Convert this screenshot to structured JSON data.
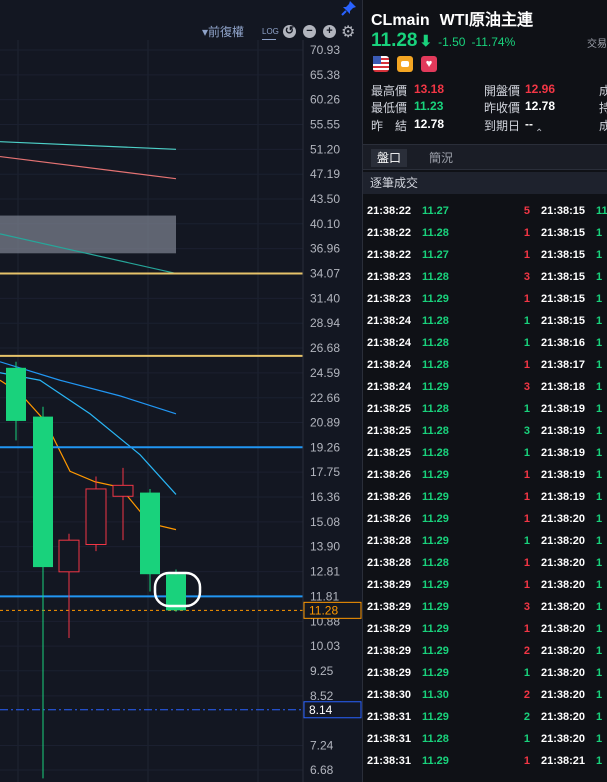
{
  "toolbar": {
    "adjust_label": "▾前復權",
    "log_label": "LOG",
    "reset_symbol": "↺",
    "zoom_out_symbol": "−",
    "zoom_in_symbol": "+",
    "settings_symbol": "⚙"
  },
  "chart_data": {
    "type": "candlestick",
    "y_axis_ticks": [
      "70.93",
      "65.38",
      "60.26",
      "55.55",
      "51.20",
      "47.19",
      "43.50",
      "40.10",
      "36.96",
      "34.07",
      "31.40",
      "28.94",
      "26.68",
      "24.59",
      "22.66",
      "20.89",
      "19.26",
      "17.75",
      "16.36",
      "15.08",
      "13.90",
      "12.81",
      "11.81",
      "10.88",
      "10.03",
      "9.25",
      "8.52",
      "7.24",
      "6.68"
    ],
    "y_log_scale": true,
    "current_price_tag": "11.28",
    "reference_price_tag": "8.14",
    "horizontal_lines": [
      {
        "value": 34.07,
        "color": "#e6c36a"
      },
      {
        "value": 26.0,
        "color": "#e6c36a"
      },
      {
        "value": 19.26,
        "color": "#2196f3"
      },
      {
        "value": 11.81,
        "color": "#2196f3"
      },
      {
        "value": 11.28,
        "color": "#ff9800"
      },
      {
        "value": 8.14,
        "color": "#2962ff"
      }
    ],
    "candles": [
      {
        "open": 25.0,
        "high": 25.5,
        "low": 19.7,
        "close": 21.0,
        "color": "green"
      },
      {
        "open": 21.3,
        "high": 22.0,
        "low": 6.5,
        "close": 13.0,
        "color": "green"
      },
      {
        "open": 12.8,
        "high": 14.5,
        "low": 10.3,
        "close": 14.2,
        "color": "red"
      },
      {
        "open": 14.0,
        "high": 17.5,
        "low": 13.7,
        "close": 16.8,
        "color": "red"
      },
      {
        "open": 16.4,
        "high": 18.0,
        "low": 14.2,
        "close": 17.0,
        "color": "red"
      },
      {
        "open": 16.6,
        "high": 16.8,
        "low": 12.0,
        "close": 12.7,
        "color": "green"
      },
      {
        "open": 12.7,
        "high": 12.9,
        "low": 11.23,
        "close": 11.28,
        "color": "green"
      }
    ],
    "moving_averages": [
      {
        "name": "MA-cyan",
        "color": "#4dd0c8",
        "values": [
          52.5,
          51.2
        ]
      },
      {
        "name": "MA-pink",
        "color": "#e57373",
        "values": [
          50.0,
          46.5
        ]
      },
      {
        "name": "MA-green",
        "color": "#26a69a",
        "values": [
          38.8,
          34.07
        ]
      },
      {
        "name": "MA-blue",
        "color": "#2196f3",
        "values": [
          25.5,
          21.5
        ]
      },
      {
        "name": "MA-lightblue",
        "color": "#29b6f6",
        "values": [
          24.6,
          16.5
        ]
      },
      {
        "name": "MA-orange",
        "color": "#ff9800",
        "values": [
          24.0,
          14.7
        ]
      }
    ],
    "shaded_band": {
      "from": 36.4,
      "to": 41.2
    }
  },
  "quote": {
    "symbol": "CLmain",
    "name": "WTI原油主連",
    "exchange": "交易",
    "price": "11.28",
    "arrow": "⬇",
    "change": "-1.50",
    "change_pct": "-11.74%",
    "colors": {
      "up": "#f23645",
      "down": "#19d27c"
    },
    "stats": {
      "high_label": "最高價",
      "high": "13.18",
      "low_label": "最低價",
      "low": "11.23",
      "prev_settle_label": "昨　結",
      "prev_settle": "12.78",
      "open_label": "開盤價",
      "open": "12.96",
      "prev_close_label": "昨收價",
      "prev_close": "12.78",
      "expiry_label": "到期日",
      "expiry": "--",
      "cut1": "成",
      "cut2": "持",
      "cut3": "成"
    },
    "expand_symbol": "⌃"
  },
  "tabs": {
    "orderbook": "盤口",
    "brief": "簡況"
  },
  "ticks_header": "逐筆成交",
  "ticks": [
    {
      "time": "21:38:22",
      "price": "11.27",
      "qty": "5",
      "dir": "up",
      "time2": "21:38:15",
      "cut": "11"
    },
    {
      "time": "21:38:22",
      "price": "11.28",
      "qty": "1",
      "dir": "up",
      "time2": "21:38:15",
      "cut": "1"
    },
    {
      "time": "21:38:22",
      "price": "11.27",
      "qty": "1",
      "dir": "up",
      "time2": "21:38:15",
      "cut": "1"
    },
    {
      "time": "21:38:23",
      "price": "11.28",
      "qty": "3",
      "dir": "up",
      "time2": "21:38:15",
      "cut": "1"
    },
    {
      "time": "21:38:23",
      "price": "11.29",
      "qty": "1",
      "dir": "up",
      "time2": "21:38:15",
      "cut": "1"
    },
    {
      "time": "21:38:24",
      "price": "11.28",
      "qty": "1",
      "dir": "down",
      "time2": "21:38:15",
      "cut": "1"
    },
    {
      "time": "21:38:24",
      "price": "11.28",
      "qty": "1",
      "dir": "down",
      "time2": "21:38:16",
      "cut": "1"
    },
    {
      "time": "21:38:24",
      "price": "11.28",
      "qty": "1",
      "dir": "up",
      "time2": "21:38:17",
      "cut": "1"
    },
    {
      "time": "21:38:24",
      "price": "11.29",
      "qty": "3",
      "dir": "up",
      "time2": "21:38:18",
      "cut": "1"
    },
    {
      "time": "21:38:25",
      "price": "11.28",
      "qty": "1",
      "dir": "down",
      "time2": "21:38:19",
      "cut": "1"
    },
    {
      "time": "21:38:25",
      "price": "11.28",
      "qty": "3",
      "dir": "down",
      "time2": "21:38:19",
      "cut": "1"
    },
    {
      "time": "21:38:25",
      "price": "11.28",
      "qty": "1",
      "dir": "down",
      "time2": "21:38:19",
      "cut": "1"
    },
    {
      "time": "21:38:26",
      "price": "11.29",
      "qty": "1",
      "dir": "up",
      "time2": "21:38:19",
      "cut": "1"
    },
    {
      "time": "21:38:26",
      "price": "11.29",
      "qty": "1",
      "dir": "up",
      "time2": "21:38:19",
      "cut": "1"
    },
    {
      "time": "21:38:26",
      "price": "11.29",
      "qty": "1",
      "dir": "up",
      "time2": "21:38:20",
      "cut": "1"
    },
    {
      "time": "21:38:28",
      "price": "11.29",
      "qty": "1",
      "dir": "down",
      "time2": "21:38:20",
      "cut": "1"
    },
    {
      "time": "21:38:28",
      "price": "11.28",
      "qty": "1",
      "dir": "up",
      "time2": "21:38:20",
      "cut": "1"
    },
    {
      "time": "21:38:29",
      "price": "11.29",
      "qty": "1",
      "dir": "up",
      "time2": "21:38:20",
      "cut": "1"
    },
    {
      "time": "21:38:29",
      "price": "11.29",
      "qty": "3",
      "dir": "up",
      "time2": "21:38:20",
      "cut": "1"
    },
    {
      "time": "21:38:29",
      "price": "11.29",
      "qty": "1",
      "dir": "up",
      "time2": "21:38:20",
      "cut": "1"
    },
    {
      "time": "21:38:29",
      "price": "11.29",
      "qty": "2",
      "dir": "up",
      "time2": "21:38:20",
      "cut": "1"
    },
    {
      "time": "21:38:29",
      "price": "11.29",
      "qty": "1",
      "dir": "down",
      "time2": "21:38:20",
      "cut": "1"
    },
    {
      "time": "21:38:30",
      "price": "11.30",
      "qty": "2",
      "dir": "up",
      "time2": "21:38:20",
      "cut": "1"
    },
    {
      "time": "21:38:31",
      "price": "11.29",
      "qty": "2",
      "dir": "down",
      "time2": "21:38:20",
      "cut": "1"
    },
    {
      "time": "21:38:31",
      "price": "11.28",
      "qty": "1",
      "dir": "down",
      "time2": "21:38:20",
      "cut": "1"
    },
    {
      "time": "21:38:31",
      "price": "11.29",
      "qty": "1",
      "dir": "up",
      "time2": "21:38:21",
      "cut": "1"
    }
  ]
}
